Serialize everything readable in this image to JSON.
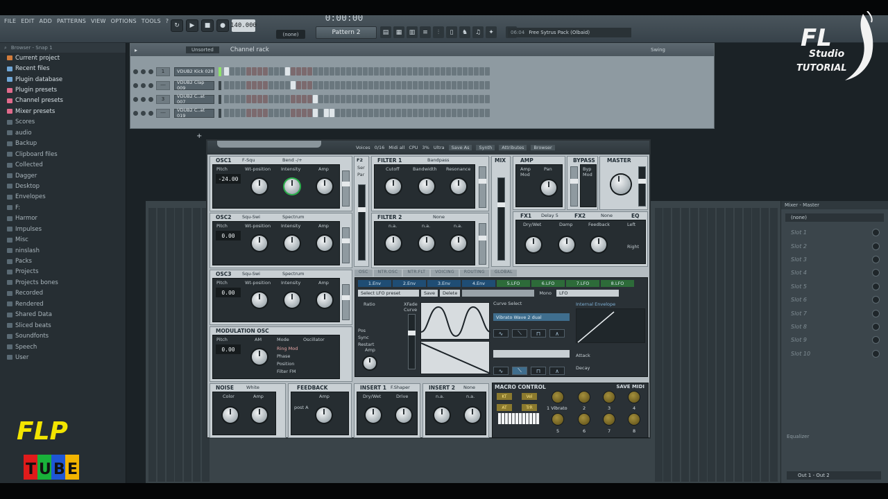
{
  "menu": [
    "FILE",
    "EDIT",
    "ADD",
    "PATTERNS",
    "VIEW",
    "OPTIONS",
    "TOOLS",
    "?"
  ],
  "transport": {
    "tempo": "140.000",
    "time": "0:00:00",
    "none_selector": "(none)",
    "pattern": "Pattern 2"
  },
  "hint": {
    "number": "06:04",
    "text": "Free Sytrus Pack (Olbaid)"
  },
  "browser": {
    "header": "Browser - Snap 1",
    "items": [
      "Current project",
      "Recent files",
      "Plugin database",
      "Plugin presets",
      "Channel presets",
      "Mixer presets",
      "Scores",
      "audio",
      "Backup",
      "Clipboard files",
      "Collected",
      "Dagger",
      "Desktop",
      "Envelopes",
      "F:",
      "Harmor",
      "Impulses",
      "Misc",
      "ninslash",
      "Packs",
      "Projects",
      "Projects bones",
      "Recorded",
      "Rendered",
      "Shared Data",
      "Sliced beats",
      "Soundfonts",
      "Speech",
      "User"
    ]
  },
  "rack": {
    "filter": "Unsorted",
    "title": "Channel rack",
    "swing": "Swing",
    "channels": [
      {
        "num": "1",
        "name": "VDUB2 Kick 028",
        "on": [
          0,
          11
        ]
      },
      {
        "num": "---",
        "name": "VDUB2 Clap 009",
        "on": [
          12
        ]
      },
      {
        "num": "3",
        "name": "VDUB2 C..at 007",
        "on": [
          16
        ]
      },
      {
        "num": "---",
        "name": "VDUB2 C..at 019",
        "on": [
          16,
          18,
          19
        ]
      }
    ],
    "add_label": "+"
  },
  "mixer": {
    "title": "Mixer - Master",
    "insert": "(none)",
    "slots": [
      "Slot 1",
      "Slot 2",
      "Slot 3",
      "Slot 4",
      "Slot 5",
      "Slot 6",
      "Slot 7",
      "Slot 8",
      "Slot 9",
      "Slot 10"
    ],
    "equalizer": "Equalizer",
    "output": "Out 1 - Out 2"
  },
  "synth": {
    "header": {
      "voices": "Voices",
      "voices_val": "0/16",
      "midi": "Midi all",
      "cpu": "CPU",
      "cpu_val": "3%",
      "quality": "Ultra",
      "save_as": "Save As",
      "synth": "Synth",
      "attributes": "Attributes",
      "browser": "Browser"
    },
    "osc1": {
      "title": "OSC1",
      "wave": "F-Squ",
      "mode": "Bend -/+",
      "pitch_label": "Pitch",
      "pitch": "-24.00",
      "wt": "Wt-position",
      "intensity": "Intensity",
      "amp": "Amp"
    },
    "osc2": {
      "title": "OSC2",
      "wave": "Squ-Swi",
      "mode": "Spectrum",
      "pitch_label": "Pitch",
      "pitch": "0.00",
      "wt": "Wt-position",
      "intensity": "Intensity",
      "amp": "Amp"
    },
    "osc3": {
      "title": "OSC3",
      "wave": "Squ-Swi",
      "mode": "Spectrum",
      "pitch_label": "Pitch",
      "pitch": "0.00",
      "wt": "Wt-position",
      "intensity": "Intensity",
      "amp": "Amp"
    },
    "modosc": {
      "title": "MODULATION OSC",
      "pitch_label": "Pitch",
      "pitch": "0.00",
      "am": "AM",
      "mode": "Mode",
      "oscillator": "Oscillator",
      "ring": "Ring Mod",
      "phase": "Phase",
      "position": "Position",
      "filterfm": "Filter FM"
    },
    "f2": {
      "title": "F2",
      "ser": "Ser",
      "par": "Par"
    },
    "filter1": {
      "title": "FILTER 1",
      "type": "Bandpass",
      "cutoff": "Cutoff",
      "bandwidth": "Bandwidth",
      "resonance": "Resonance"
    },
    "filter2": {
      "title": "FILTER 2",
      "type": "None",
      "na": "n.a."
    },
    "mix": {
      "title": "MIX"
    },
    "amp": {
      "title": "AMP",
      "amp_mod": "Amp Mod",
      "pan": "Pan"
    },
    "bypass": {
      "title": "BYPASS",
      "byp_mod": "Byp Mod"
    },
    "master": {
      "title": "MASTER"
    },
    "fx1": {
      "title": "FX1",
      "type": "Delay 5",
      "drywet": "Dry/Wet",
      "damp": "Damp",
      "feedback": "Feedback",
      "left": "Left",
      "right": "Right"
    },
    "fx2": {
      "title": "FX2",
      "type": "None"
    },
    "eq": {
      "title": "EQ"
    },
    "tabs": [
      "OSC",
      "NTR.OSC",
      "NTR.FLT",
      "VOICING",
      "ROUTING",
      "GLOBAL"
    ],
    "env_tabs": [
      "1.Env",
      "2.Env",
      "3.Env",
      "4.Env",
      "5.LFO",
      "6.LFO",
      "7.LFO",
      "8.LFO"
    ],
    "lfo": {
      "select": "Select LFO preset",
      "save": "Save",
      "delete": "Delete",
      "ratio": "Ratio",
      "xfade": "XFade",
      "curve": "Curve",
      "pos": "Pos",
      "sync": "Sync",
      "restart": "Restart",
      "amp": "Amp",
      "curve_select": "Curve Select",
      "vibrato": "Vibrato Wave 2 dual",
      "mono": "Mono",
      "lfo_mode": "LFO",
      "internal": "Internal Envelope",
      "attack": "Attack",
      "decay": "Decay"
    },
    "noise": {
      "title": "NOISE",
      "type": "White",
      "color": "Color",
      "amp": "Amp"
    },
    "feedback": {
      "title": "FEEDBACK",
      "amp": "Amp",
      "posta": "post A"
    },
    "insert1": {
      "title": "INSERT 1",
      "type": "F.Shaper",
      "drywet": "Dry/Wet",
      "drive": "Drive"
    },
    "insert2": {
      "title": "INSERT 2",
      "type": "None",
      "na": "n.a."
    },
    "macro": {
      "title": "MACRO CONTROL",
      "save": "SAVE MIDI",
      "buttons": [
        "KT",
        "Vel",
        "AT",
        "TrR"
      ],
      "label1": "1 Vibrato",
      "nums": [
        "2",
        "3",
        "4",
        "5",
        "6",
        "7",
        "8"
      ]
    }
  },
  "watermarks": {
    "fl1": "FL",
    "fl2": "Studio",
    "fl3": "TUTORIAL",
    "flp": "FLP",
    "tube": [
      "T",
      "U",
      "B",
      "E"
    ]
  }
}
